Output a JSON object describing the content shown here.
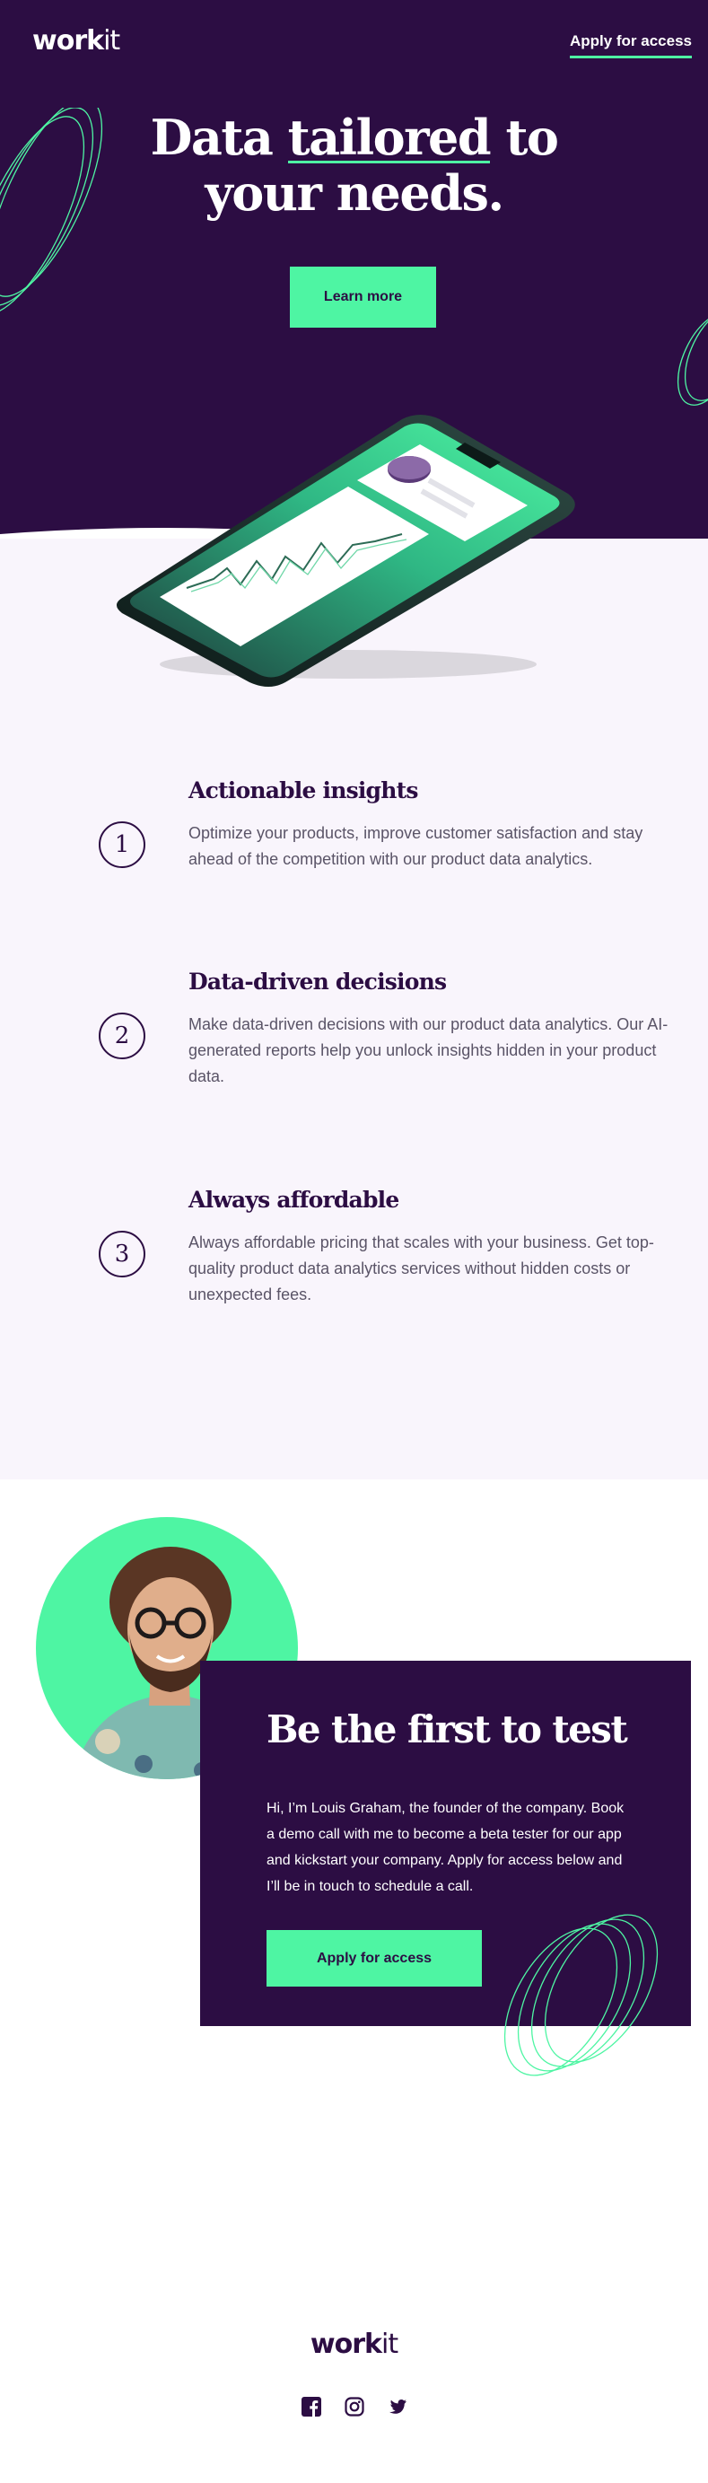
{
  "brand": {
    "logo_bold": "work",
    "logo_light": "it"
  },
  "nav": {
    "apply_link": "Apply for access"
  },
  "hero": {
    "title_pre": "Data ",
    "title_highlight": "tailored",
    "title_post": " to",
    "title_line2": "your needs.",
    "cta_label": "Learn more"
  },
  "features": [
    {
      "number": "1",
      "title": "Actionable insights",
      "text": "Optimize your products, improve customer satisfaction and stay ahead of the competition with our product data analytics."
    },
    {
      "number": "2",
      "title": "Data-driven decisions",
      "text": "Make data-driven decisions with our product data analytics. Our AI-generated reports help you unlock insights hidden in your product data."
    },
    {
      "number": "3",
      "title": "Always affordable",
      "text": "Always affordable pricing that scales with your business. Get top-quality product data analytics services without hidden costs or unexpected fees."
    }
  ],
  "cta": {
    "title": "Be the first to test",
    "text": "Hi, I’m Louis Graham, the founder of the company. Book a demo call with me to become a beta tester for our app and kickstart your company. Apply for access below and I’ll be in touch to schedule a call.",
    "button_label": "Apply for access"
  },
  "footer": {
    "logo_bold": "work",
    "logo_light": "it"
  },
  "colors": {
    "primary": "#2c0d43",
    "accent": "#4ef5a3",
    "light_bg": "#f9f5fc"
  },
  "icons": [
    "facebook-icon",
    "instagram-icon",
    "twitter-icon"
  ]
}
